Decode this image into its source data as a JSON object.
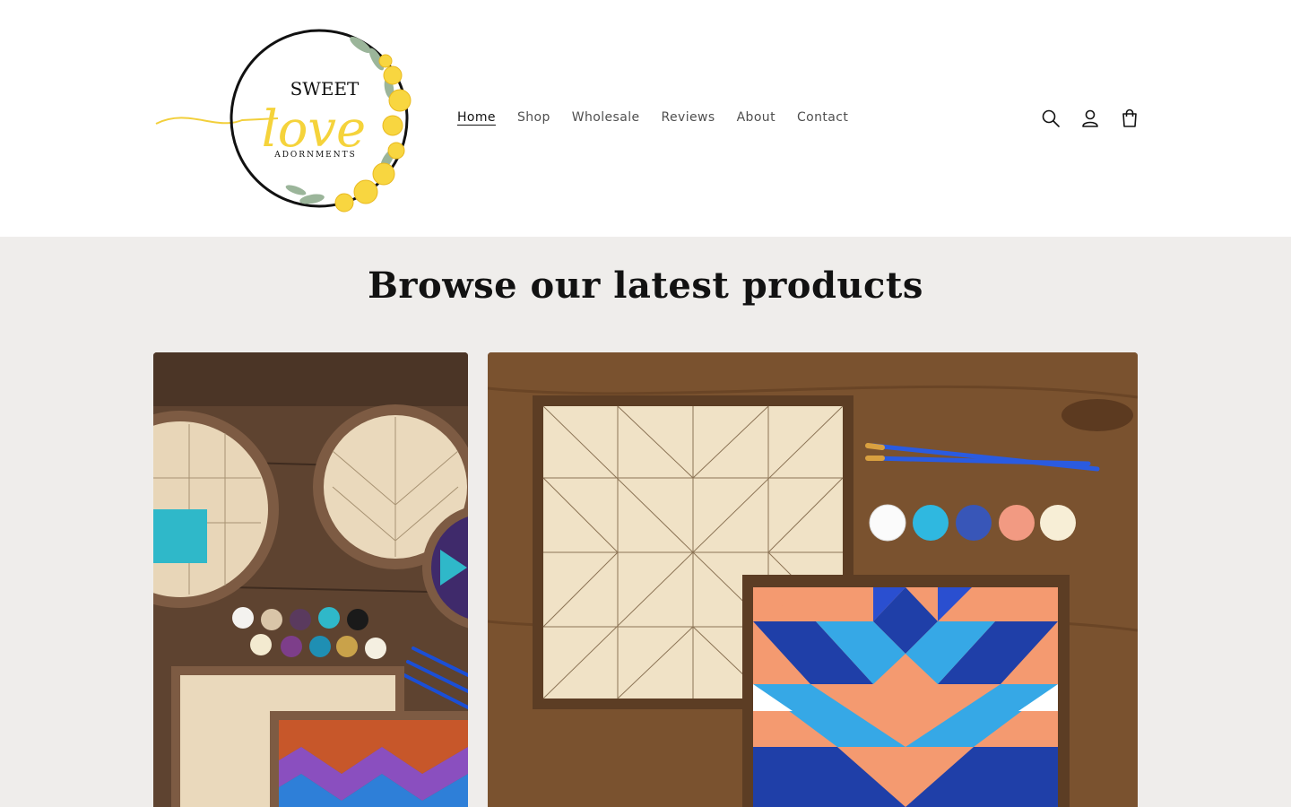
{
  "brand": {
    "line1": "SWEET",
    "line2": "love",
    "line3": "ADORNMENTS"
  },
  "nav": {
    "items": [
      {
        "label": "Home",
        "active": true
      },
      {
        "label": "Shop",
        "active": false
      },
      {
        "label": "Wholesale",
        "active": false
      },
      {
        "label": "Reviews",
        "active": false
      },
      {
        "label": "About",
        "active": false
      },
      {
        "label": "Contact",
        "active": false
      }
    ]
  },
  "header_icons": [
    "search-icon",
    "account-icon",
    "cart-icon"
  ],
  "section": {
    "title": "Browse our latest products"
  },
  "products": {
    "paint_pots_left": [
      "White",
      "Sable",
      "Plum",
      "Azure",
      "Black",
      "Vanilla",
      "Aubergine",
      "Ocean",
      "Gold",
      "Glue"
    ],
    "paint_pots_right": [
      "White",
      "Turquoise",
      "Dark Blue",
      "Deep Coral",
      "Glue"
    ]
  },
  "colors": {
    "accent": "#f5d33b",
    "wood": "#6b4a2f",
    "section_bg": "#efedeb"
  }
}
